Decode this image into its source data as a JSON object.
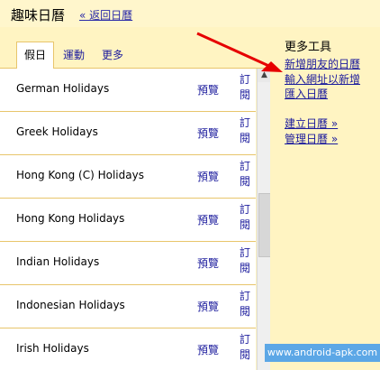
{
  "header": {
    "title": "趣味日曆",
    "back_link": "« 返回日曆"
  },
  "tabs": [
    {
      "label": "假日"
    },
    {
      "label": "運動"
    },
    {
      "label": "更多"
    }
  ],
  "list": [
    {
      "name": "German Holidays",
      "preview": "預覽",
      "subscribe": "訂閱"
    },
    {
      "name": "Greek Holidays",
      "preview": "預覽",
      "subscribe": "訂閱"
    },
    {
      "name": "Hong Kong (C) Holidays",
      "preview": "預覽",
      "subscribe": "訂閱"
    },
    {
      "name": "Hong Kong Holidays",
      "preview": "預覽",
      "subscribe": "訂閱"
    },
    {
      "name": "Indian Holidays",
      "preview": "預覽",
      "subscribe": "訂閱"
    },
    {
      "name": "Indonesian Holidays",
      "preview": "預覽",
      "subscribe": "訂閱"
    },
    {
      "name": "Irish Holidays",
      "preview": "預覽",
      "subscribe": "訂閱"
    }
  ],
  "more_tools": {
    "title": "更多工具",
    "links": [
      "新增朋友的日曆",
      "輸入網址以新增",
      "匯入日曆",
      "建立日曆 »",
      "管理日曆 »"
    ]
  },
  "watermark": "www.android-apk.com"
}
